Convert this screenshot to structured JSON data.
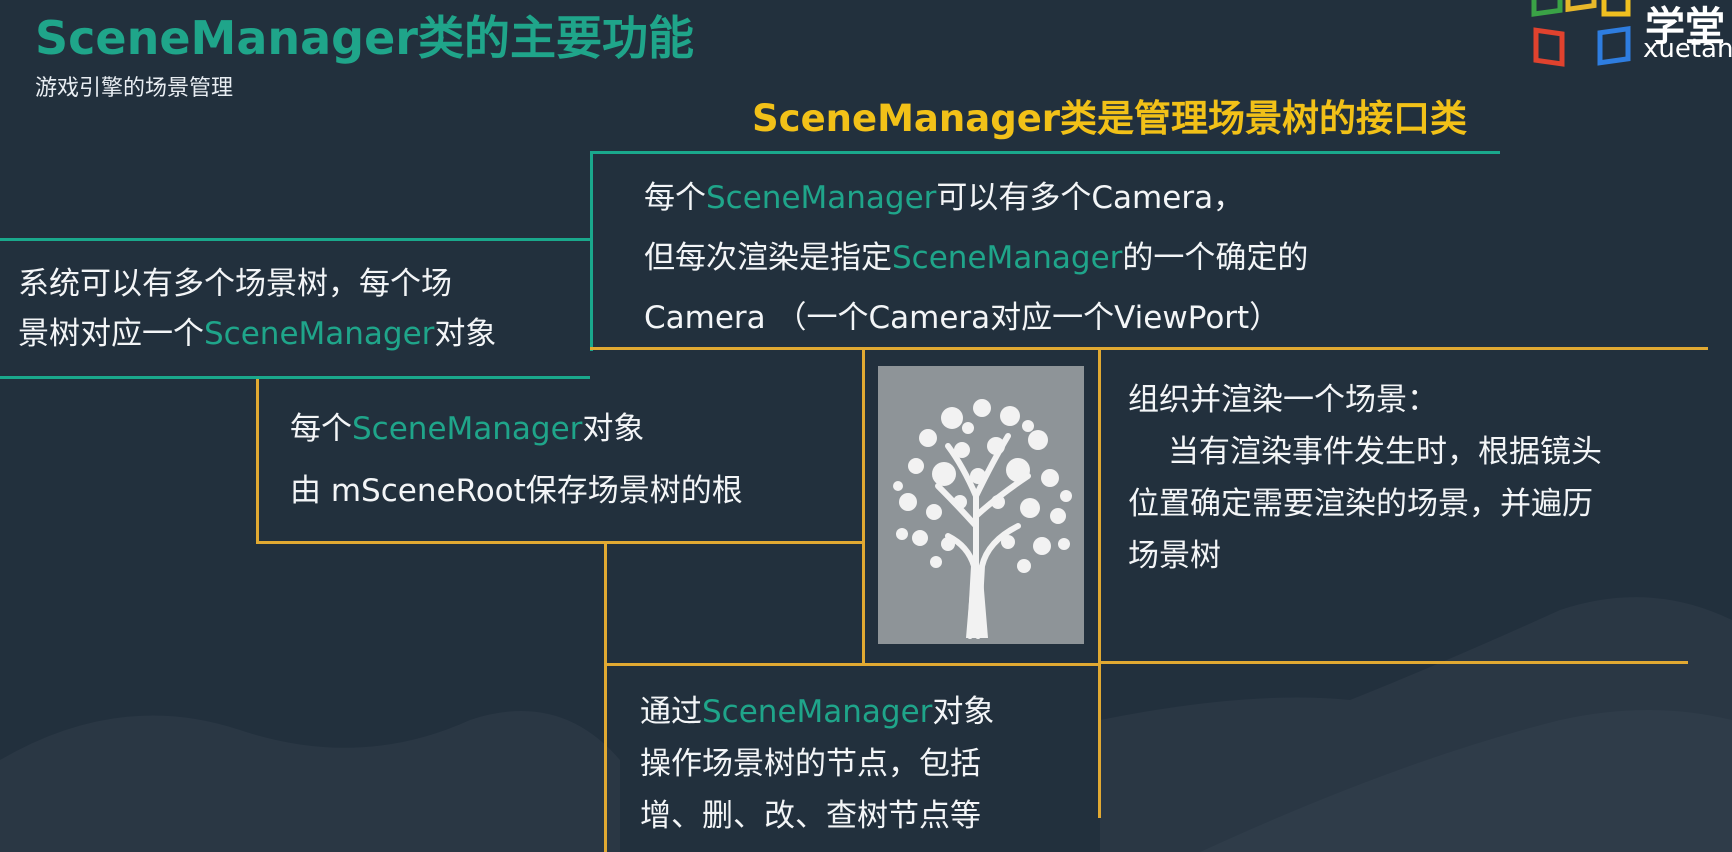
{
  "header": {
    "title": "SceneManager类的主要功能",
    "subtitle": "游戏引擎的场景管理"
  },
  "logo": {
    "text_cn": "学堂",
    "text_en": "xuetan"
  },
  "headline": "SceneManager类是管理场景树的接口类",
  "boxes": {
    "system": {
      "line1": "系统可以有多个场景树，每个场",
      "line2_prefix": "景树对应一个",
      "line2_hl": "SceneManager",
      "line2_suffix": "对象"
    },
    "camera": {
      "line1_prefix": "每个",
      "line1_hl": "SceneManager",
      "line1_suffix": "可以有多个Camera，",
      "line2_prefix": "但每次渲染是指定",
      "line2_hl": "SceneManager",
      "line2_suffix": "的一个确定的",
      "line3": "Camera （一个Camera对应一个ViewPort）"
    },
    "root": {
      "line1_prefix": "每个",
      "line1_hl": "SceneManager",
      "line1_suffix": "对象",
      "line2": "由 mSceneRoot保存场景树的根"
    },
    "render": {
      "line1": "组织并渲染一个场景：",
      "line2": "当有渲染事件发生时，根据镜头",
      "line3": "位置确定需要渲染的场景，并遍历",
      "line4": "场景树"
    },
    "nodes": {
      "line1_prefix": "通过",
      "line1_hl": "SceneManager",
      "line1_suffix": "对象",
      "line2": "操作场景树的节点，包括",
      "line3": "增、删、改、查树节点等"
    }
  },
  "colors": {
    "background": "#22303d",
    "teal": "#1fa58a",
    "gold": "#e1a932",
    "headline": "#f2c118"
  },
  "icons": {
    "tree": "tree-icon",
    "logo": "xuetang-logo-icon"
  }
}
